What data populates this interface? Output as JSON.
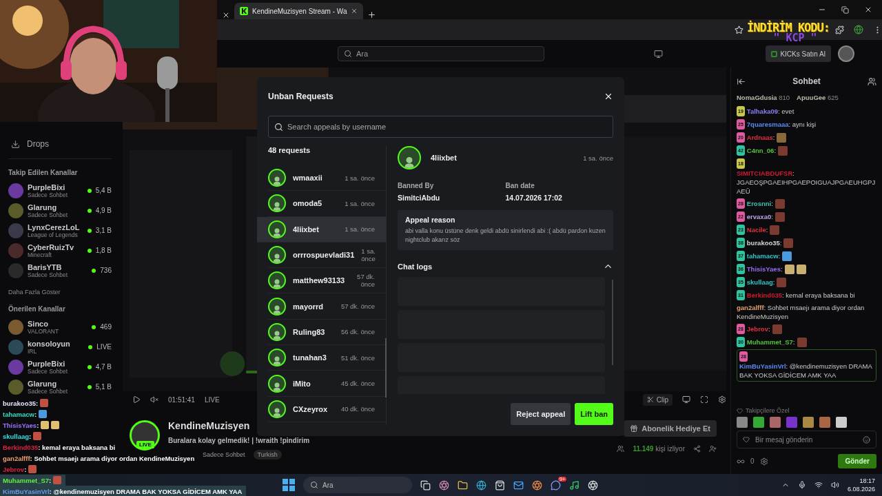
{
  "browser": {
    "tabs": [
      {
        "title": "KendineMuzisyen Stream - Wa",
        "selected": true
      }
    ]
  },
  "promo": {
    "title": "İNDİRİM KODU:",
    "code": "\" KCP \""
  },
  "header": {
    "search_placeholder": "Ara",
    "kicks_button": "KICKs Satın Al"
  },
  "sidebar": {
    "drops": "Drops",
    "followed_title": "Takip Edilen Kanallar",
    "followed": [
      {
        "name": "PurpleBixi",
        "category": "Sadece Sohbet",
        "viewers": "5,4 B"
      },
      {
        "name": "Glarung",
        "category": "Sadece Sohbet",
        "viewers": "4,9 B"
      },
      {
        "name": "LynxCerezLoL",
        "category": "League of Legends",
        "viewers": "3,1 B"
      },
      {
        "name": "CyberRuizTv",
        "category": "Minecraft",
        "viewers": "1,8 B"
      },
      {
        "name": "BarisYTB",
        "category": "Sadece Sohbet",
        "viewers": "736"
      }
    ],
    "show_more": "Daha Fazla Göster",
    "recommended_title": "Önerilen Kanallar",
    "recommended": [
      {
        "name": "Sinco",
        "category": "VALORANT",
        "viewers": "469"
      },
      {
        "name": "konsoloyun",
        "category": "IRL",
        "viewers": "LIVE"
      },
      {
        "name": "PurpleBixi",
        "category": "Sadece Sohbet",
        "viewers": "4,7 B"
      },
      {
        "name": "Glarung",
        "category": "Sadece Sohbet",
        "viewers": "5,1 B"
      }
    ]
  },
  "player": {
    "time": "01:51:41",
    "live": "LIVE",
    "clip": "Clip"
  },
  "stream_info": {
    "channel": "KendineMuzisyen",
    "avatar_badge": "LIVE",
    "title": "Buralara kolay gelmedik! | !wraith !pindirim",
    "tags": [
      "Sadece Sohbet",
      "Turkish"
    ],
    "gift_button": "Abonelik Hediye Et",
    "viewers": "11.149",
    "viewers_label": "kişi izliyor"
  },
  "chat": {
    "title": "Sohbet",
    "leaders": [
      {
        "name": "NomaGdusia",
        "score": "810"
      },
      {
        "name": "ApuuGee",
        "score": "625"
      }
    ],
    "messages": [
      {
        "badge": {
          "label": "19",
          "color": "#c8c84a"
        },
        "user": "Talhaka09",
        "color": "#8a7ff0",
        "text": ": evet",
        "highlighted": false
      },
      {
        "badge": {
          "label": "25",
          "color": "#e05aa0"
        },
        "user": "7quaresmaaa",
        "color": "#5a8af0",
        "text": ": aynı kişi",
        "highlighted": false
      },
      {
        "badge": {
          "label": "20",
          "color": "#e05aa0"
        },
        "user": "Ardnaas",
        "color": "#e03040",
        "text": ":",
        "emotes": [
          {
            "color": "#8a6a3a"
          }
        ],
        "highlighted": false
      },
      {
        "badge": {
          "label": "42",
          "color": "#2ec4a0"
        },
        "user": "C4nn_06",
        "color": "#53c43a",
        "text": ":",
        "emotes": [
          {
            "color": "#7a3a30"
          }
        ],
        "highlighted": false
      },
      {
        "badge": {
          "label": "18",
          "color": "#c8c84a"
        },
        "user": "SIMITCIABDUFSR",
        "color": "#d01830",
        "text": ": JGAEOŞPGAEIHPGAEPOIGUAJPGAEUHGPJAEÜ",
        "highlighted": false
      },
      {
        "badge": {
          "label": "28",
          "color": "#e05aa0"
        },
        "user": "Erosnni",
        "color": "#3ac4b0",
        "text": ":",
        "emotes": [
          {
            "color": "#7a3a30"
          }
        ],
        "highlighted": false
      },
      {
        "badge": {
          "label": "22",
          "color": "#e05aa0"
        },
        "user": "ervaxa0",
        "color": "#c0a0e0",
        "text": ":",
        "emotes": [
          {
            "color": "#7a3a30"
          }
        ],
        "highlighted": false
      },
      {
        "badge": {
          "label": "23",
          "color": "#2ec4a0"
        },
        "user": "Nacile",
        "color": "#e03040",
        "text": ":",
        "emotes": [
          {
            "color": "#7a3a30"
          }
        ],
        "highlighted": false
      },
      {
        "badge": {
          "label": "38",
          "color": "#2ec4a0"
        },
        "user": "burakoo35",
        "color": "#d8d8d8",
        "text": ":",
        "emotes": [
          {
            "color": "#7a3a30"
          }
        ],
        "highlighted": false
      },
      {
        "badge": {
          "label": "37",
          "color": "#2ec4a0"
        },
        "user": "tahamacw",
        "color": "#2ec4c4",
        "text": ":",
        "emotes": [
          {
            "color": "#4a9ae0"
          }
        ],
        "highlighted": false
      },
      {
        "badge": {
          "label": "36",
          "color": "#2ec4a0"
        },
        "user": "ThisisYaes",
        "color": "#9a6af0",
        "text": ":",
        "emotes": [
          {
            "color": "#c8b070"
          },
          {
            "color": "#c8b070"
          }
        ],
        "highlighted": false
      },
      {
        "badge": {
          "label": "35",
          "color": "#2ec4a0"
        },
        "user": "skullaag",
        "color": "#2ec4c4",
        "text": ":",
        "emotes": [
          {
            "color": "#7a3a30"
          }
        ],
        "highlighted": false
      },
      {
        "badge": {
          "label": "31",
          "color": "#2ec4a0"
        },
        "user": "Berkind035",
        "color": "#d01830",
        "text": ": kemal eraya baksana bi",
        "highlighted": false
      },
      {
        "user": "gan2alfff",
        "color": "#e0a070",
        "text": ": Sohbet msaejı arama diyor ordan KendineMuzisyen",
        "highlighted": false
      },
      {
        "badge": {
          "label": "28",
          "color": "#e05aa0"
        },
        "user": "Jebrov",
        "color": "#e03040",
        "text": ":",
        "emotes": [
          {
            "color": "#7a3a30"
          }
        ],
        "highlighted": false
      },
      {
        "badge": {
          "label": "30",
          "color": "#2ec4a0"
        },
        "user": "Muhammet_S7",
        "color": "#53c43a",
        "text": ":",
        "emotes": [
          {
            "color": "#7a3a30"
          }
        ],
        "highlighted": false
      },
      {
        "badge": {
          "label": "28",
          "color": "#e05aa0"
        },
        "user": "KimBuYasinVrl",
        "color": "#5a8af0",
        "text": ": @kendinemuzisyen DRAMA BAK YOKSA GİDİCEM AMK YAA",
        "highlighted": true
      }
    ],
    "followers_only": "Takipçilere Özel",
    "input_placeholder": "Bir mesaj gönderin",
    "points": "0",
    "send": "Gönder"
  },
  "modal": {
    "title": "Unban Requests",
    "search_placeholder": "Search appeals by username",
    "count": "48 requests",
    "requests": [
      {
        "name": "wmaaxii",
        "time": "1 sa. önce",
        "selected": false
      },
      {
        "name": "omoda5",
        "time": "1 sa. önce",
        "selected": false
      },
      {
        "name": "4liixbet",
        "time": "1 sa. önce",
        "selected": true
      },
      {
        "name": "orrrospuevladi31",
        "time": "1 sa. önce",
        "selected": false
      },
      {
        "name": "matthew93133",
        "time": "57 dk. önce",
        "selected": false
      },
      {
        "name": "mayorrd",
        "time": "57 dk. önce",
        "selected": false
      },
      {
        "name": "Ruling83",
        "time": "56 dk. önce",
        "selected": false
      },
      {
        "name": "tunahan3",
        "time": "51 dk. önce",
        "selected": false
      },
      {
        "name": "iMito",
        "time": "45 dk. önce",
        "selected": false
      },
      {
        "name": "CXzeyrox",
        "time": "40 dk. önce",
        "selected": false
      }
    ],
    "detail": {
      "name": "4liixbet",
      "time": "1 sa. önce",
      "banned_by_label": "Banned By",
      "banned_by": "SimitciAbdu",
      "ban_date_label": "Ban date",
      "ban_date": "14.07.2026 17:02",
      "appeal_title": "Appeal reason",
      "appeal_text": "abi valla konu üstüne denk geldi abdü sinirlendi abi :( abdü pardon kuzen nightclub akarız söz",
      "chat_logs_title": "Chat logs",
      "chat_logs_expanded": true
    },
    "reject_button": "Reject appeal",
    "lift_button": "Lift ban"
  },
  "overlay_chat": [
    {
      "user": "burakoo35",
      "color": "#e8e8ff",
      "text": ":",
      "emotes": [
        {
          "color": "#c05040"
        }
      ],
      "boxed": false
    },
    {
      "user": "tahamacw",
      "color": "#2ee0c0",
      "text": ":",
      "emotes": [
        {
          "color": "#4a9ae0"
        }
      ],
      "boxed": false
    },
    {
      "user": "ThisisYaes",
      "color": "#a070ff",
      "text": ":",
      "emotes": [
        {
          "color": "#e0c070"
        },
        {
          "color": "#e0c070"
        }
      ],
      "boxed": false
    },
    {
      "user": "skullaag",
      "color": "#2ee0e0",
      "text": ":",
      "emotes": [
        {
          "color": "#c05040"
        }
      ],
      "boxed": false
    },
    {
      "user": "Berkind035",
      "color": "#e02040",
      "text": ": kemal eraya baksana bi",
      "boxed": false
    },
    {
      "user": "gan2alfff",
      "color": "#f0a070",
      "text": ": Sohbet msaejı arama diyor ordan KendineMuzisyen",
      "boxed": false
    },
    {
      "user": "Jebrov",
      "color": "#e02040",
      "text": ":",
      "emotes": [
        {
          "color": "#c05040"
        }
      ],
      "boxed": false
    },
    {
      "user": "Muhammet_S7",
      "color": "#60f040",
      "text": ":",
      "emotes": [
        {
          "color": "#c05040"
        }
      ],
      "boxed": true
    },
    {
      "user": "KimBuYasinVrl",
      "color": "#6a9af0",
      "text": ": @kendinemuzisyen DRAMA BAK YOKSA GİDİCEM AMK YAA",
      "boxed": true
    }
  ],
  "taskbar": {
    "search_placeholder": "Ara",
    "app_badge": "9+",
    "time": "18:17",
    "date": "6.08.2026"
  }
}
